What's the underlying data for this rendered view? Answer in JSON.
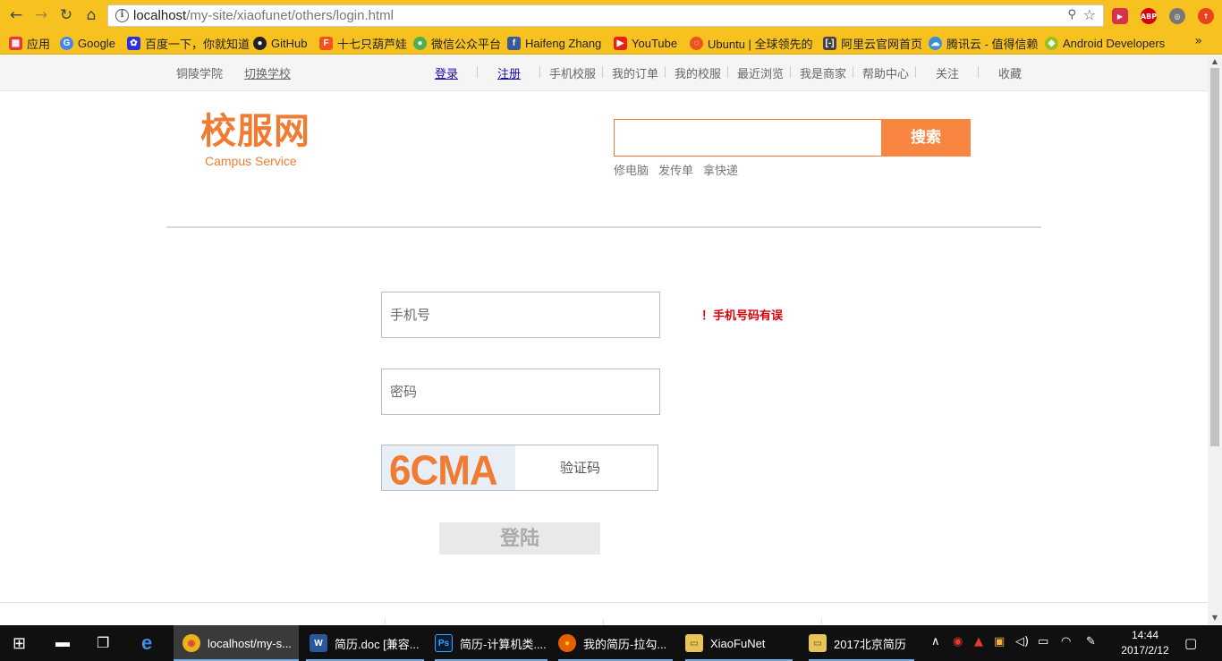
{
  "browser": {
    "url_host": "localhost",
    "url_path": "/my-site/xiaofunet/others/login.html",
    "bookmarks": [
      {
        "label": "应用",
        "icon": "apps-grid-icon",
        "color": "#e53935"
      },
      {
        "label": "Google",
        "icon": "google-icon",
        "color": "#4285f4"
      },
      {
        "label": "百度一下，你就知道",
        "icon": "baidu-icon",
        "color": "#2932e1"
      },
      {
        "label": "GitHub",
        "icon": "github-icon",
        "color": "#222222"
      },
      {
        "label": "十七只葫芦娃",
        "icon": "orange-f-icon",
        "color": "#f4511e"
      },
      {
        "label": "微信公众平台",
        "icon": "wechat-icon",
        "color": "#4caf50"
      },
      {
        "label": "Haifeng Zhang",
        "icon": "facebook-icon",
        "color": "#3b5998"
      },
      {
        "label": "YouTube",
        "icon": "youtube-icon",
        "color": "#e62117"
      },
      {
        "label": "Ubuntu | 全球领先的",
        "icon": "ubuntu-icon",
        "color": "#e95420"
      },
      {
        "label": "阿里云官网首页",
        "icon": "aliyun-icon",
        "color": "#444444"
      },
      {
        "label": "腾讯云 - 值得信赖",
        "icon": "tencent-cloud-icon",
        "color": "#3a8fd9"
      },
      {
        "label": "Android Developers",
        "icon": "android-icon",
        "color": "#97c024"
      }
    ],
    "more": "»"
  },
  "topbar": {
    "school": "铜陵学院",
    "switch_school": "切换学校",
    "login": "登录",
    "register": "注册",
    "links": [
      "手机校服",
      "我的订单",
      "我的校服",
      "最近浏览",
      "我是商家",
      "帮助中心",
      "关注",
      "收藏"
    ]
  },
  "logo": {
    "cn": "校服网",
    "en": "Campus Service"
  },
  "search": {
    "button": "搜索",
    "hot": [
      "修电脑",
      "发传单",
      "拿快递"
    ]
  },
  "form": {
    "phone_placeholder": "手机号",
    "password_placeholder": "密码",
    "captcha_text": "6CMA",
    "captcha_placeholder": "验证码",
    "error": "！手机号码有误",
    "submit": "登陆"
  },
  "taskbar": {
    "items": [
      {
        "label": "localhost/my-s...",
        "icon": "chrome-icon"
      },
      {
        "label": "简历.doc [兼容...",
        "icon": "word-icon"
      },
      {
        "label": "简历-计算机类....",
        "icon": "photoshop-icon"
      },
      {
        "label": "我的简历-拉勾...",
        "icon": "firefox-icon"
      },
      {
        "label": "XiaoFuNet",
        "icon": "folder-icon"
      },
      {
        "label": "2017北京简历",
        "icon": "folder-icon"
      }
    ],
    "time": "14:44",
    "date": "2017/2/12"
  }
}
